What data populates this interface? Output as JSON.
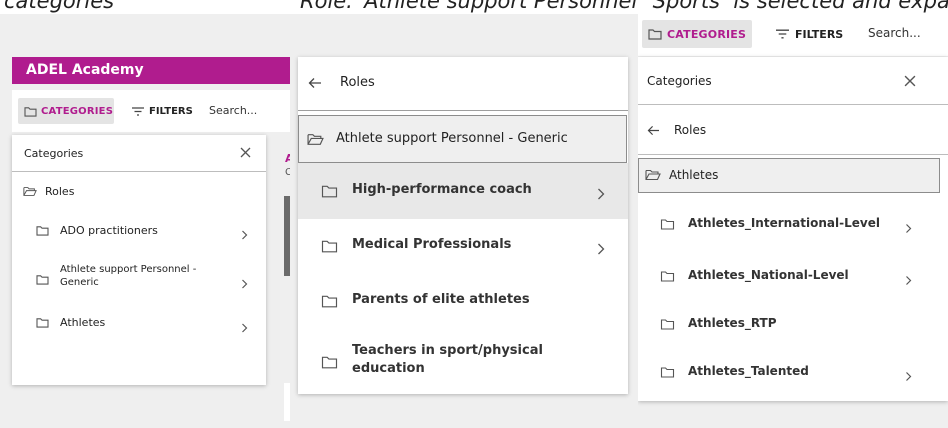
{
  "captions": {
    "left": "categories",
    "middle": "Role: ‘Athlete support Personnel – Generic’ selected",
    "right": "‘Sports’ is selected and expanded to ‘Athletes’"
  },
  "panel1": {
    "app_title": "ADEL Academy",
    "toolbar": {
      "categories_label": "CATEGORIES",
      "filters_label": "FILTERS",
      "search_placeholder": "Search..."
    },
    "dialog_title": "Categories",
    "root_label": "Roles",
    "items": [
      {
        "label": "ADO practitioners"
      },
      {
        "label": "Athlete support Personnel -",
        "label2": "Generic"
      },
      {
        "label": "Athletes"
      }
    ],
    "behind_letter1": "A",
    "behind_letter2": "C"
  },
  "panel2": {
    "back_label": "Roles",
    "selected_label": "Athlete support Personnel - Generic",
    "items": [
      {
        "label": "High-performance coach"
      },
      {
        "label": "Medical Professionals"
      },
      {
        "label": "Parents of elite athletes"
      },
      {
        "label": "Teachers in sport/physical",
        "label2": "education"
      }
    ]
  },
  "panel3": {
    "toolbar": {
      "categories_label": "CATEGORIES",
      "filters_label": "FILTERS",
      "search_label": "Search..."
    },
    "dialog_title": "Categories",
    "back_label": "Roles",
    "selected_label": "Athletes",
    "items": [
      {
        "label": "Athletes_International-Level"
      },
      {
        "label": "Athletes_National-Level"
      },
      {
        "label": "Athletes_RTP"
      },
      {
        "label": "Athletes_Talented"
      }
    ]
  },
  "colors": {
    "brand": "#b01c8e",
    "panel_bg": "#efefef",
    "card": "#ffffff",
    "selected": "#e8e8e8"
  },
  "icons": [
    "folder-icon",
    "folder-open-icon",
    "filter-icon",
    "close-icon",
    "chevron-right-icon",
    "arrow-left-icon"
  ]
}
